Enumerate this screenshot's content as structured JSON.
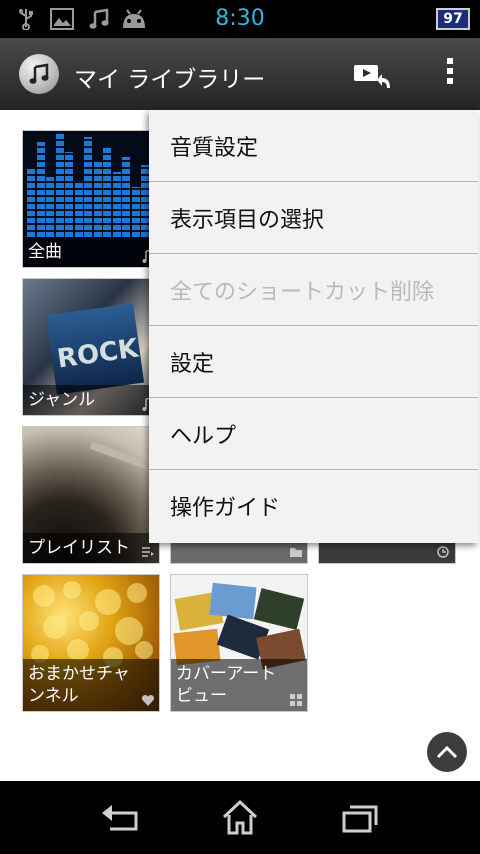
{
  "status_bar": {
    "time": "8:30",
    "battery": "97",
    "icons": [
      "usb-icon",
      "image-notification-icon",
      "music-note-icon",
      "android-icon"
    ]
  },
  "action_bar": {
    "title": "マイ ライブラリー",
    "app_icon": "music-note-icon",
    "actions": [
      "cast-icon",
      "overflow-menu-icon"
    ]
  },
  "grid": {
    "tiles": [
      {
        "label": "全曲",
        "badge": "music-note-icon"
      },
      {
        "label": "ジャンル",
        "badge": "music-note-icon"
      },
      {
        "label": "プレイリスト",
        "badge": "playlist-icon"
      },
      {
        "label": "",
        "badge": "folder-icon"
      },
      {
        "label": "",
        "badge": "recent-icon"
      },
      {
        "label": "おまかせチャンネル",
        "badge": "heart-note-icon"
      },
      {
        "label": "カバーアートビュー",
        "badge": "grid-icon"
      }
    ],
    "genre_art_text": "ROCK"
  },
  "menu": {
    "items": [
      {
        "label": "音質設定",
        "enabled": true
      },
      {
        "label": "表示項目の選択",
        "enabled": true
      },
      {
        "label": "全てのショートカット削除",
        "enabled": false
      },
      {
        "label": "設定",
        "enabled": true
      },
      {
        "label": "ヘルプ",
        "enabled": true
      },
      {
        "label": "操作ガイド",
        "enabled": true
      }
    ]
  },
  "nav_bar": {
    "buttons": [
      "back-icon",
      "home-icon",
      "recent-apps-icon"
    ]
  },
  "colors": {
    "clock": "#33b5e5",
    "battery_fill": "#1c2e7a",
    "menu_background": "#f2f2f2",
    "disabled_text": "#b9b9b9"
  }
}
